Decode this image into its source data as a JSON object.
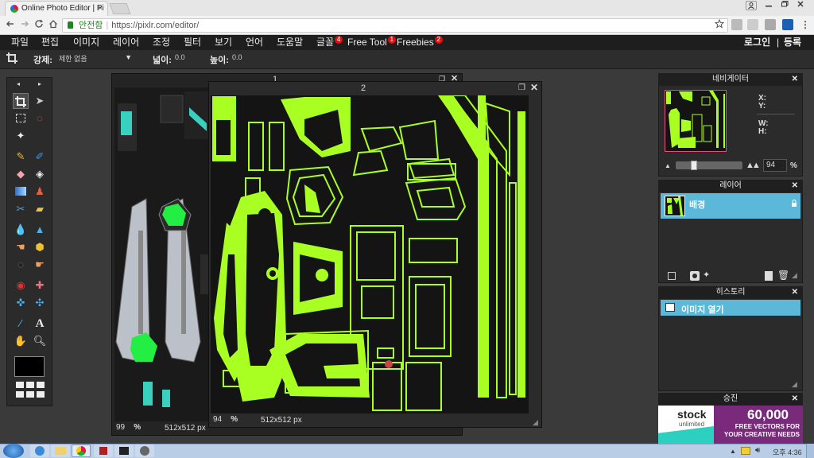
{
  "browser": {
    "tab_title": "Online Photo Editor | Pi",
    "tab_close": "×",
    "secure_label": "안전함",
    "url": "https://pixlr.com/editor/",
    "bookmark_icon": "star-icon",
    "menu_icon": "kebab-menu-icon"
  },
  "menu": {
    "file": "파일",
    "edit": "편집",
    "image": "이미지",
    "layer": "레이어",
    "adjust": "조정",
    "filter": "필터",
    "view": "보기",
    "language": "언어",
    "help": "도움말",
    "fonts": "글꼴",
    "fonts_badge": "4",
    "free_tool": "Free Tool",
    "free_tool_badge": "1",
    "freebies": "Freebies",
    "freebies_badge": "2",
    "login": "로그인",
    "separator": "|",
    "register": "등록"
  },
  "options": {
    "constraint_label": "강제:",
    "constraint_value": "제한 없음",
    "width_label": "넓이:",
    "width_value": "0.0",
    "height_label": "높이:",
    "height_value": "0.0"
  },
  "documents": [
    {
      "title": "1",
      "zoom": "99",
      "zoom_unit": "%",
      "size": "512x512 px"
    },
    {
      "title": "2",
      "zoom": "94",
      "zoom_unit": "%",
      "size": "512x512 px"
    }
  ],
  "navigator": {
    "title": "네비게이터",
    "x_label": "X:",
    "y_label": "Y:",
    "w_label": "W:",
    "h_label": "H:",
    "zoom_value": "94",
    "zoom_unit": "%",
    "zoom_level": 0.25
  },
  "layers": {
    "title": "레이어",
    "items": [
      {
        "name": "배경"
      }
    ]
  },
  "history": {
    "title": "히스토리",
    "items": [
      {
        "name": "이미지 열기"
      }
    ]
  },
  "promo": {
    "title": "승진",
    "brand": "stock",
    "brand_sub": "unlimited",
    "headline": "60,000",
    "line1": "FREE VECTORS FOR",
    "line2": "YOUR CREATIVE NEEDS"
  },
  "taskbar": {
    "language": "오후",
    "time": "4:36"
  },
  "colors": {
    "accent": "#5bb8d8",
    "badge": "#dd1111",
    "texture_green": "#aaff22"
  }
}
